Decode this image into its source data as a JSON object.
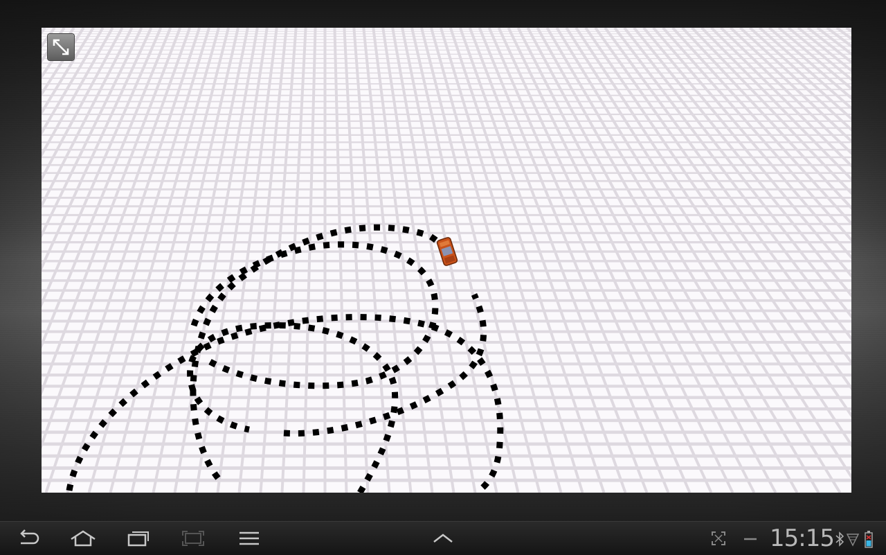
{
  "game": {
    "name": "car-drift-sandbox",
    "floor_color": "#fbf9fc",
    "grid_color": "#ded9e0",
    "trail_color": "#000000",
    "car_body_color": "#c9521a",
    "car_window_color": "#8a93b3"
  },
  "overlay": {
    "fullscreen_icon": "expand-arrows-icon"
  },
  "system_bar": {
    "back_icon": "back-icon",
    "home_icon": "home-icon",
    "recents_icon": "recent-apps-icon",
    "screenshot_icon": "screenshot-icon",
    "menu_icon": "menu-icon",
    "expand_icon": "chevron-up-icon",
    "fit_icon": "screen-fit-icon",
    "minus_icon": "minus-icon",
    "time": "15:15",
    "bluetooth_icon": "bluetooth-icon",
    "signal_icon": "signal-icon",
    "battery_icon": "battery-icon"
  }
}
